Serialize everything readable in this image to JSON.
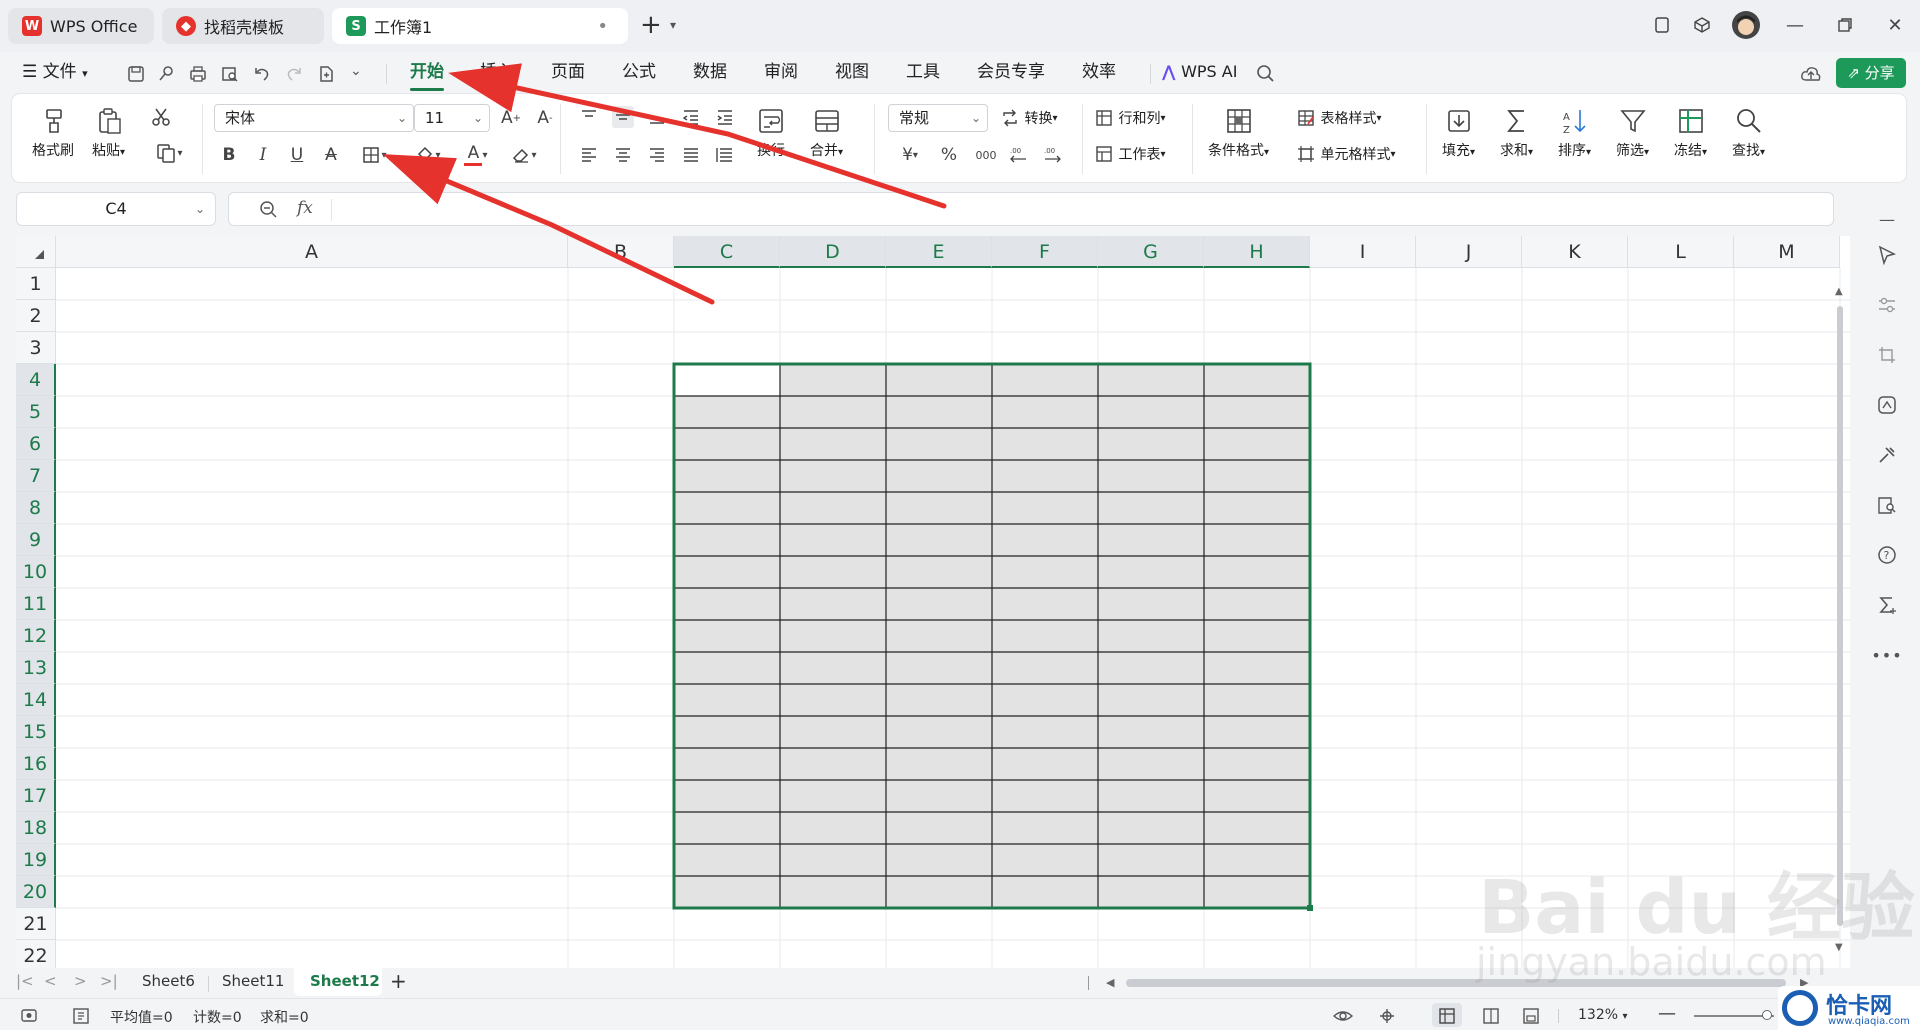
{
  "titlebar": {
    "tabs": [
      {
        "label": "WPS Office"
      },
      {
        "label": "找稻壳模板"
      },
      {
        "label": "工作簿1"
      }
    ],
    "modified_dot": "•",
    "new_tab": "+"
  },
  "menu": {
    "file": "文件",
    "items": [
      "开始",
      "插入",
      "页面",
      "公式",
      "数据",
      "审阅",
      "视图",
      "工具",
      "会员专享",
      "效率"
    ],
    "active": "开始",
    "wps_ai": "WPS AI",
    "share": "分享"
  },
  "ribbon": {
    "format_painter": "格式刷",
    "paste": "粘贴",
    "font_name": "宋体",
    "font_size": "11",
    "bold": "B",
    "italic": "I",
    "underline": "U",
    "wrap": "换行",
    "merge": "合并",
    "number_format": "常规",
    "convert": "转换",
    "percent": "%",
    "thousands": "000",
    "row_col": "行和列",
    "worksheet": "工作表",
    "cond_format": "条件格式",
    "table_style": "表格样式",
    "cell_style": "单元格样式",
    "fill": "填充",
    "sum": "求和",
    "sort": "排序",
    "filter": "筛选",
    "freeze": "冻结",
    "find": "查找"
  },
  "formula_bar": {
    "name_box": "C4",
    "fx": "fx"
  },
  "sheet": {
    "columns": [
      "A",
      "B",
      "C",
      "D",
      "E",
      "F",
      "G",
      "H",
      "I",
      "J",
      "K",
      "L",
      "M"
    ],
    "selected_columns": [
      "C",
      "D",
      "E",
      "F",
      "G",
      "H"
    ],
    "rows": [
      "1",
      "2",
      "3",
      "4",
      "5",
      "6",
      "7",
      "8",
      "9",
      "10",
      "11",
      "12",
      "13",
      "14",
      "15",
      "16",
      "17",
      "18",
      "19",
      "20",
      "21",
      "22"
    ],
    "selected_rows": [
      "4",
      "5",
      "6",
      "7",
      "8",
      "9",
      "10",
      "11",
      "12",
      "13",
      "14",
      "15",
      "16",
      "17",
      "18",
      "19",
      "20"
    ],
    "active_cell": "C4",
    "selection_range": "C4:H20",
    "accent_color": "#1d7a4a",
    "selection_fill": "#e3e3e3",
    "annotation_color": "#e5322d"
  },
  "sheet_tabs": {
    "tabs": [
      "Sheet6",
      "Sheet11",
      "Sheet12"
    ],
    "active": "Sheet12",
    "add": "+"
  },
  "status": {
    "avg": "平均值=0",
    "count": "计数=0",
    "sum": "求和=0",
    "zoom": "132%"
  },
  "watermark": {
    "main": "Bai du 经验",
    "url": "jingyan.baidu.com",
    "corner": "恰卡网",
    "corner_url": "www.qiaqia.com"
  }
}
